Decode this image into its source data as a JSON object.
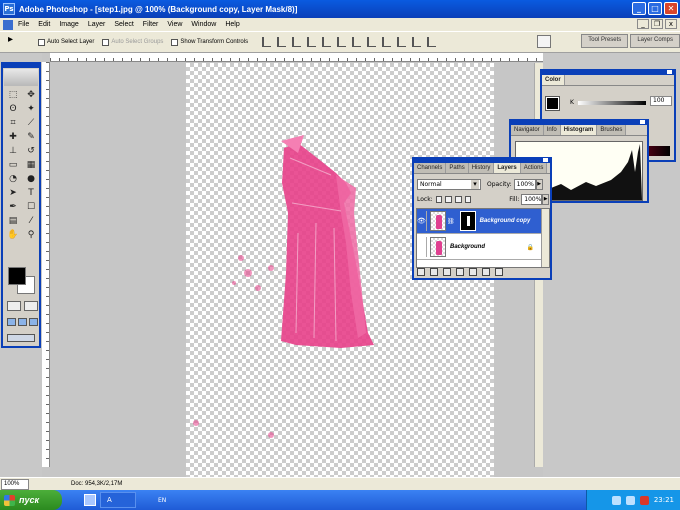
{
  "window": {
    "title": "Adobe Photoshop - [step1.jpg @ 100% (Background copy, Layer Mask/8)]",
    "min": "_",
    "max": "□",
    "close": "✕"
  },
  "menu": [
    "File",
    "Edit",
    "Image",
    "Layer",
    "Select",
    "Filter",
    "View",
    "Window",
    "Help"
  ],
  "mdi": {
    "min": "_",
    "restore": "❐",
    "close": "x"
  },
  "options": {
    "tool_arrow": "▸",
    "auto_select_layer": "Auto Select Layer",
    "auto_select_groups": "Auto Select Groups",
    "show_transform_controls": "Show Transform Controls"
  },
  "wells": {
    "tool_presets": "Tool Presets",
    "layer_comps": "Layer Comps"
  },
  "toolbox": {
    "tools": [
      {
        "name": "marquee-tool",
        "glyph": "⬚"
      },
      {
        "name": "move-tool",
        "glyph": "✥"
      },
      {
        "name": "lasso-tool",
        "glyph": "ʘ"
      },
      {
        "name": "magic-wand-tool",
        "glyph": "✦"
      },
      {
        "name": "crop-tool",
        "glyph": "⌗"
      },
      {
        "name": "slice-tool",
        "glyph": "⟋"
      },
      {
        "name": "healing-brush-tool",
        "glyph": "✚"
      },
      {
        "name": "brush-tool",
        "glyph": "✎"
      },
      {
        "name": "clone-stamp-tool",
        "glyph": "⊥"
      },
      {
        "name": "history-brush-tool",
        "glyph": "↺"
      },
      {
        "name": "eraser-tool",
        "glyph": "▭"
      },
      {
        "name": "gradient-tool",
        "glyph": "▦"
      },
      {
        "name": "blur-tool",
        "glyph": "◔"
      },
      {
        "name": "dodge-tool",
        "glyph": "●"
      },
      {
        "name": "path-selection-tool",
        "glyph": "➤"
      },
      {
        "name": "type-tool",
        "glyph": "T"
      },
      {
        "name": "pen-tool",
        "glyph": "✒"
      },
      {
        "name": "shape-tool",
        "glyph": "☐"
      },
      {
        "name": "notes-tool",
        "glyph": "▤"
      },
      {
        "name": "eyedropper-tool",
        "glyph": "⁄"
      },
      {
        "name": "hand-tool",
        "glyph": "✋"
      },
      {
        "name": "zoom-tool",
        "glyph": "⚲"
      }
    ]
  },
  "color_panel": {
    "tab": "Color",
    "channel": "K",
    "value": "100"
  },
  "histogram_panel": {
    "tabs": [
      "Navigator",
      "Info",
      "Histogram",
      "Brushes"
    ],
    "active": 2
  },
  "layers_panel": {
    "tabs": [
      "Channels",
      "Paths",
      "History",
      "Layers",
      "Actions"
    ],
    "active": 3,
    "blend_mode": "Normal",
    "opacity_label": "Opacity:",
    "opacity": "100%",
    "lock_label": "Lock:",
    "fill_label": "Fill:",
    "fill": "100%",
    "layers": [
      {
        "name": "Background copy",
        "selected": true
      },
      {
        "name": "Background",
        "selected": false
      }
    ]
  },
  "status": {
    "zoom": "100%",
    "doc": "Doc: 954,3K/2,17M"
  },
  "taskbar": {
    "start": "пуск",
    "task": "A",
    "lang": "EN",
    "clock": "23:21"
  },
  "colors": {
    "dress": "#e8408a",
    "title_blue": "#0a5be0",
    "taskbar_blue": "#245edb",
    "start_green": "#3a9b2c"
  }
}
